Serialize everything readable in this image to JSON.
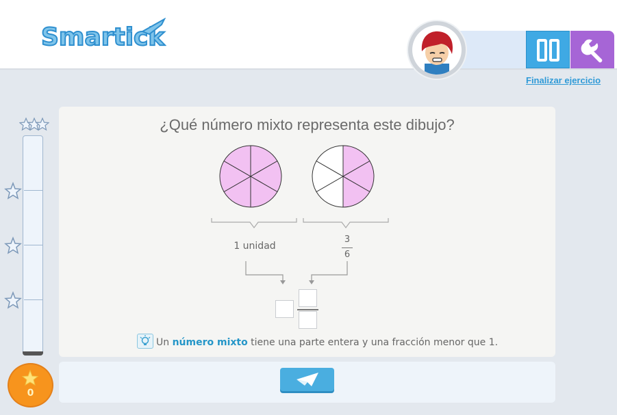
{
  "header": {
    "logo_text": "Smartick",
    "finish_link": "Finalizar ejercicio",
    "pause_icon": "pause-icon",
    "tools_icon": "wrench-icon"
  },
  "progress": {
    "coin_count": "0",
    "star_levels": 3
  },
  "exercise": {
    "question": "¿Qué número mixto representa este dibujo?",
    "pies": [
      {
        "slices": 6,
        "shaded": 6
      },
      {
        "slices": 6,
        "shaded": 3
      }
    ],
    "label_whole": "1 unidad",
    "label_fraction_numerator": "3",
    "label_fraction_denominator": "6",
    "answer_whole": "",
    "answer_numerator": "",
    "answer_denominator": ""
  },
  "hint": {
    "prefix": "Un",
    "keyword": "número mixto",
    "suffix": "tiene una parte entera y una fracción menor que 1."
  },
  "colors": {
    "pie_fill": "#f2c1f2",
    "accent_blue": "#3fa9e4",
    "accent_purple": "#a665d6",
    "coin": "#f7941d"
  },
  "send_icon": "paper-plane-icon"
}
